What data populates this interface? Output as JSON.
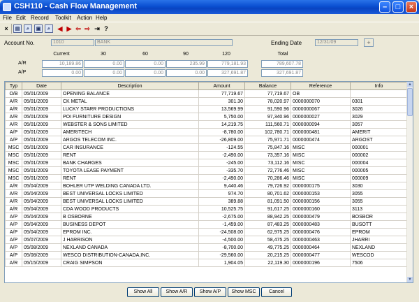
{
  "window": {
    "title": "CSH110 - Cash Flow Management"
  },
  "menu": [
    "File",
    "Edit",
    "Record",
    "Toolkit",
    "Action",
    "Help"
  ],
  "toolbar": [
    {
      "icon": "close-x-icon",
      "glyph": "×"
    },
    {
      "icon": "print-icon",
      "glyph": "▤"
    },
    {
      "icon": "search-icon",
      "glyph": "⌕"
    },
    {
      "icon": "view-icon",
      "glyph": "▣"
    },
    {
      "icon": "find-icon",
      "glyph": "⌕"
    },
    {
      "icon": "prev-icon",
      "glyph": "◀"
    },
    {
      "icon": "next-icon",
      "glyph": "▶"
    },
    {
      "icon": "arrow-left-icon",
      "glyph": "⇦"
    },
    {
      "icon": "arrow-right-icon",
      "glyph": "⇨"
    },
    {
      "icon": "export-icon",
      "glyph": "⇥"
    },
    {
      "icon": "help-icon",
      "glyph": "?"
    }
  ],
  "account": {
    "label": "Account No.",
    "number": "1010",
    "name": "BANK"
  },
  "ending": {
    "label": "Ending Date",
    "value": "12/31/09"
  },
  "aging": {
    "headers": [
      "Current",
      "30",
      "60",
      "90",
      "120",
      "Total"
    ],
    "ar": {
      "label": "A/R",
      "values": [
        "10,189.86",
        "0.00",
        "0.00",
        "235.99",
        "779,181.93",
        "789,607.78"
      ]
    },
    "ap": {
      "label": "A/P",
      "values": [
        "0.00",
        "0.00",
        "0.00",
        "0.00",
        "327,691.87",
        "327,691.87"
      ]
    }
  },
  "table": {
    "columns": [
      "Typ",
      "Date",
      "Description",
      "Amount",
      "Balance",
      "Reference",
      "Info"
    ],
    "rows": [
      [
        "O/B",
        "05/01/2009",
        "OPENING BALANCE",
        "77,719.67",
        "77,719.67",
        "OB",
        ""
      ],
      [
        "A/R",
        "05/01/2009",
        "CK METAL",
        "301.30",
        "78,020.97",
        "0000000070",
        "0301"
      ],
      [
        "A/R",
        "05/01/2009",
        "LUCKY STARR PRODUCTIONS",
        "13,569.99",
        "91,590.96",
        "0000000067",
        "3026"
      ],
      [
        "A/R",
        "05/01/2009",
        "POI FURNITURE DESIGN",
        "5,750.00",
        "97,340.96",
        "0000000027",
        "3029"
      ],
      [
        "A/R",
        "05/01/2009",
        "WEBSTER & SONS LIMITED",
        "14,219.75",
        "111,560.71",
        "0000000094",
        "3057"
      ],
      [
        "A/P",
        "05/01/2009",
        "AMERITECH",
        "-8,780.00",
        "102,780.71",
        "0000000481",
        "AMERIT"
      ],
      [
        "A/P",
        "05/01/2009",
        "ARGOS TELECOM INC.",
        "-26,809.00",
        "75,971.71",
        "0000000474",
        "ARGOST"
      ],
      [
        "MSC",
        "05/01/2009",
        "CAR INSURANCE",
        "-124.55",
        "75,847.16",
        "MISC",
        "000001"
      ],
      [
        "MSC",
        "05/01/2009",
        "RENT",
        "-2,490.00",
        "73,357.16",
        "MISC",
        "000002"
      ],
      [
        "MSC",
        "05/01/2009",
        "BANK CHARGES",
        "-245.00",
        "73,112.16",
        "MISC",
        "000004"
      ],
      [
        "MSC",
        "05/01/2009",
        "TOYOTA LEASE PAYMENT",
        "-335.70",
        "72,776.46",
        "MISC",
        "000005"
      ],
      [
        "MSC",
        "05/01/2009",
        "RENT",
        "-2,490.00",
        "70,286.46",
        "MISC",
        "000009"
      ],
      [
        "A/R",
        "05/04/2009",
        "BOHLER UTP WELDING CANADA LTD.",
        "9,440.46",
        "79,726.92",
        "0000000175",
        "3030"
      ],
      [
        "A/R",
        "05/04/2009",
        "BEST UNIVERSAL LOCKS LIMITED",
        "974.70",
        "80,701.62",
        "0000000153",
        "3055"
      ],
      [
        "A/R",
        "05/04/2009",
        "BEST UNIVERSAL LOCKS LIMITED",
        "389.88",
        "81,091.50",
        "0000000156",
        "3055"
      ],
      [
        "A/R",
        "05/04/2009",
        "CDA WOOD PRODUCTS",
        "10,525.75",
        "91,617.25",
        "0000000160",
        "3113"
      ],
      [
        "A/P",
        "05/04/2009",
        "B OSBORNE",
        "-2,675.00",
        "88,942.25",
        "0000000479",
        "BOSBOR"
      ],
      [
        "A/P",
        "05/04/2009",
        "BUSINESS DEPOT",
        "-1,459.00",
        "87,483.25",
        "0000000483",
        "BUSOTT"
      ],
      [
        "A/P",
        "05/04/2009",
        "EPROM INC.",
        "-24,508.00",
        "62,975.25",
        "0000000476",
        "EPROM"
      ],
      [
        "A/P",
        "05/07/2009",
        "J HARRISON",
        "-4,500.00",
        "58,475.25",
        "0000000463",
        "JHARRI"
      ],
      [
        "A/P",
        "05/08/2009",
        "NEXLAND CANADA",
        "-8,700.00",
        "49,775.25",
        "0000000464",
        "NEXLAND"
      ],
      [
        "A/P",
        "05/08/2009",
        "WESCO DISTRIBUTION-CANADA,INC.",
        "-29,560.00",
        "20,215.25",
        "0000000477",
        "WESCOD"
      ],
      [
        "A/R",
        "05/15/2009",
        "CRAIG SIMPSON",
        "1,904.05",
        "22,119.30",
        "0000000196",
        "7506"
      ]
    ]
  },
  "buttons": {
    "show_all": "Show All",
    "show_ar": "Show A/R",
    "show_ap": "Show A/P",
    "show_msc": "Show MSC",
    "cancel": "Cancel"
  }
}
